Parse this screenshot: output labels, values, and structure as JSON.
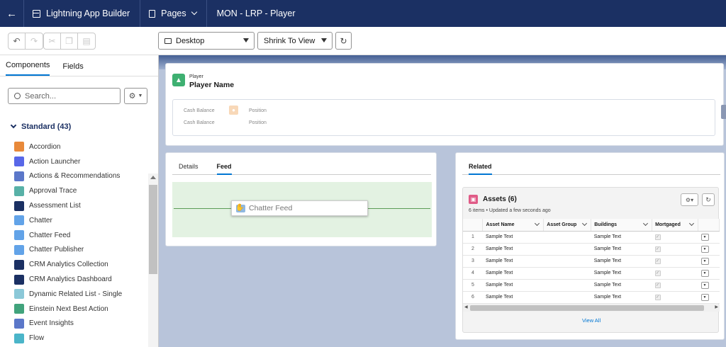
{
  "topbar": {
    "app_name": "Lightning App Builder",
    "pages_label": "Pages",
    "page_title": "MON - LRP - Player"
  },
  "toolbar": {
    "device": "Desktop",
    "view_mode": "Shrink To View"
  },
  "sidebar": {
    "tabs": [
      "Components",
      "Fields"
    ],
    "search_placeholder": "Search...",
    "section_label": "Standard (43)",
    "components": [
      {
        "label": "Accordion",
        "color": "#e8893a",
        "icon": "accordion-icon"
      },
      {
        "label": "Action Launcher",
        "color": "#5867e8",
        "icon": "bolt-icon"
      },
      {
        "label": "Actions & Recommendations",
        "color": "#5b77c9",
        "icon": "list-icon"
      },
      {
        "label": "Approval Trace",
        "color": "#58b1a7",
        "icon": "approval-icon"
      },
      {
        "label": "Assessment List",
        "color": "#1b3063",
        "icon": "checkbox-icon"
      },
      {
        "label": "Chatter",
        "color": "#62a3e8",
        "icon": "chatter-icon"
      },
      {
        "label": "Chatter Feed",
        "color": "#62a3e8",
        "icon": "feed-icon"
      },
      {
        "label": "Chatter Publisher",
        "color": "#62a3e8",
        "icon": "bolt-icon"
      },
      {
        "label": "CRM Analytics Collection",
        "color": "#1b3063",
        "icon": "bar-chart-icon"
      },
      {
        "label": "CRM Analytics Dashboard",
        "color": "#1b3063",
        "icon": "bar-chart-icon"
      },
      {
        "label": "Dynamic Related List - Single",
        "color": "#8bc8d8",
        "icon": "related-list-icon"
      },
      {
        "label": "Einstein Next Best Action",
        "color": "#41a37c",
        "icon": "einstein-icon"
      },
      {
        "label": "Event Insights",
        "color": "#5b77c9",
        "icon": "insights-icon"
      },
      {
        "label": "Flow",
        "color": "#4bb5c9",
        "icon": "flow-icon"
      }
    ]
  },
  "header_card": {
    "object_type": "Player",
    "record_name": "Player Name",
    "highlights": {
      "field1_label": "Cash Balance",
      "field2_label": "Cash Balance",
      "field3_label": "Position",
      "field4_label": "Position"
    }
  },
  "feed_card": {
    "tabs": [
      "Details",
      "Feed"
    ],
    "active_tab": "Feed",
    "drag_label": "Chatter Feed"
  },
  "related_card": {
    "tab": "Related",
    "assets": {
      "title": "Assets (6)",
      "subtitle": "6 items • Updated a few seconds ago",
      "columns": [
        "Asset Name",
        "Asset Group",
        "Buildings",
        "Mortgaged"
      ],
      "rows": [
        {
          "n": "1",
          "name": "Sample Text",
          "group": "",
          "buildings": "Sample Text"
        },
        {
          "n": "2",
          "name": "Sample Text",
          "group": "",
          "buildings": "Sample Text"
        },
        {
          "n": "3",
          "name": "Sample Text",
          "group": "",
          "buildings": "Sample Text"
        },
        {
          "n": "4",
          "name": "Sample Text",
          "group": "",
          "buildings": "Sample Text"
        },
        {
          "n": "5",
          "name": "Sample Text",
          "group": "",
          "buildings": "Sample Text"
        },
        {
          "n": "6",
          "name": "Sample Text",
          "group": "",
          "buildings": "Sample Text"
        }
      ],
      "view_all": "View All"
    }
  }
}
